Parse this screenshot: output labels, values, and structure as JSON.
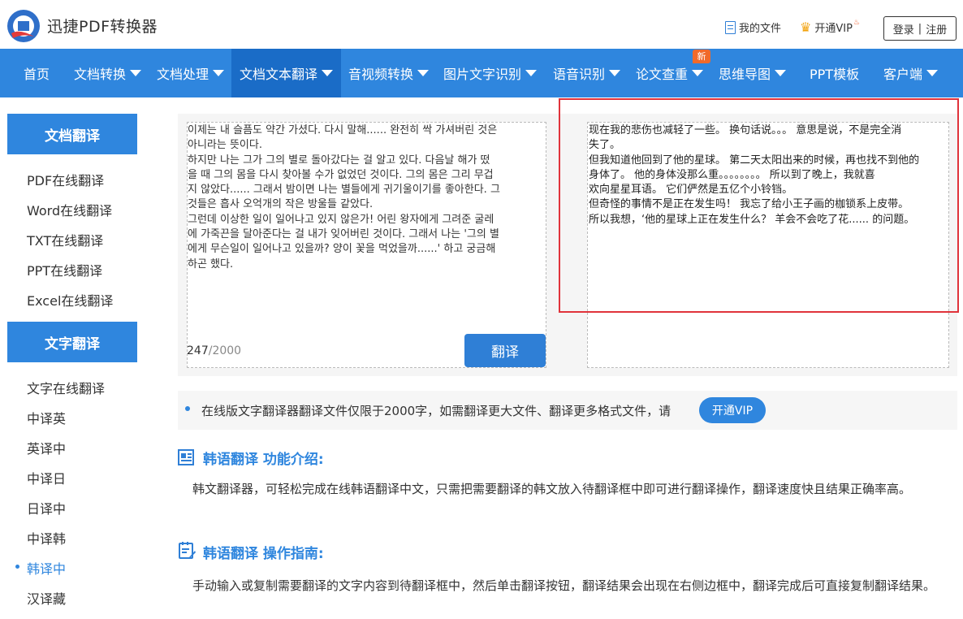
{
  "header": {
    "app_title": "迅捷PDF转换器",
    "my_files": "我的文件",
    "open_vip": "开通VIP",
    "login": "登录",
    "divider": "|",
    "register": "注册"
  },
  "nav": {
    "items": [
      {
        "label": "首页",
        "dropdown": false
      },
      {
        "label": "文档转换",
        "dropdown": true
      },
      {
        "label": "文档处理",
        "dropdown": true
      },
      {
        "label": "文档文本翻译",
        "dropdown": true,
        "active": true
      },
      {
        "label": "音视频转换",
        "dropdown": true
      },
      {
        "label": "图片文字识别",
        "dropdown": true
      },
      {
        "label": "语音识别",
        "dropdown": true
      },
      {
        "label": "论文查重",
        "dropdown": true
      },
      {
        "label": "思维导图",
        "dropdown": true
      },
      {
        "label": "PPT模板",
        "dropdown": false
      },
      {
        "label": "客户端",
        "dropdown": true
      }
    ],
    "new_badge": "新"
  },
  "sidebar": {
    "section1_title": "文档翻译",
    "section1_items": [
      "PDF在线翻译",
      "Word在线翻译",
      "TXT在线翻译",
      "PPT在线翻译",
      "Excel在线翻译"
    ],
    "section2_title": "文字翻译",
    "section2_items": [
      "文字在线翻译",
      "中译英",
      "英译中",
      "中译日",
      "日译中",
      "中译韩",
      "韩译中",
      "汉译藏"
    ],
    "active_item": "韩译中"
  },
  "translator": {
    "source_text": "이제는 내 슬픔도 약간 가셨다. 다시 말해...... 완전히 싹 가셔버린 것은\n아니라는 뜻이다.\n하지만 나는 그가 그의 별로 돌아갔다는 걸 알고 있다. 다음날 해가 떴\n을 때 그의 몸을 다시 찾아볼 수가 없었던 것이다. 그의 몸은 그리 무겁\n지 않았다...... 그래서 밤이면 나는 별들에게 귀기울이기를 좋아한다. 그\n것들은 흡사 오억개의 작은 방울들 같았다.\n그런데 이상한 일이 일어나고 있지 않은가! 어린 왕자에게 그려준 굴레\n에 가죽끈을 달아준다는 걸 내가 잊어버린 것이다. 그래서 나는 '그의 별\n에게 무슨일이 일어나고 있을까? 양이 꽃을 먹었을까......' 하고 궁금해\n하곤 했다.",
    "char_count": "247",
    "char_max": "/2000",
    "translate_button": "翻译",
    "result_text": "现在我的悲伤也减轻了一些。 换句话说。。。 意思是说，不是完全消\n失了。\n但我知道他回到了他的星球。 第二天太阳出来的时候，再也找不到他的\n身体了。 他的身体没那么重。。。。。。。。 所以到了晚上，我就喜\n欢向星星耳语。 它们俨然是五亿个小铃铛。\n但奇怪的事情不是正在发生吗！ 我忘了给小王子画的枷锁系上皮带。\n所以我想，‘他的星球上正在发生什么？ 羊会不会吃了花...... 的问题。"
  },
  "notice": {
    "text": "在线版文字翻译器翻译文件仅限于2000字，如需翻译更大文件、翻译更多格式文件，请",
    "vip_button": "开通VIP"
  },
  "intro": {
    "title": "韩语翻译 功能介绍:",
    "body": "韩文翻译器，可轻松完成在线韩语翻译中文，只需把需要翻译的韩文放入待翻译框中即可进行翻译操作，翻译速度快且结果正确率高。"
  },
  "guide": {
    "title": "韩语翻译 操作指南:",
    "body": "手动输入或复制需要翻译的文字内容到待翻译框中，然后单击翻译按钮，翻译结果会出现在右侧边框中，翻译完成后可直接复制翻译结果。"
  },
  "colors": {
    "brand_blue": "#2f86de",
    "nav_active": "#1a6cc7",
    "highlight_red": "#e0333b",
    "badge_orange": "#f06a2a"
  }
}
